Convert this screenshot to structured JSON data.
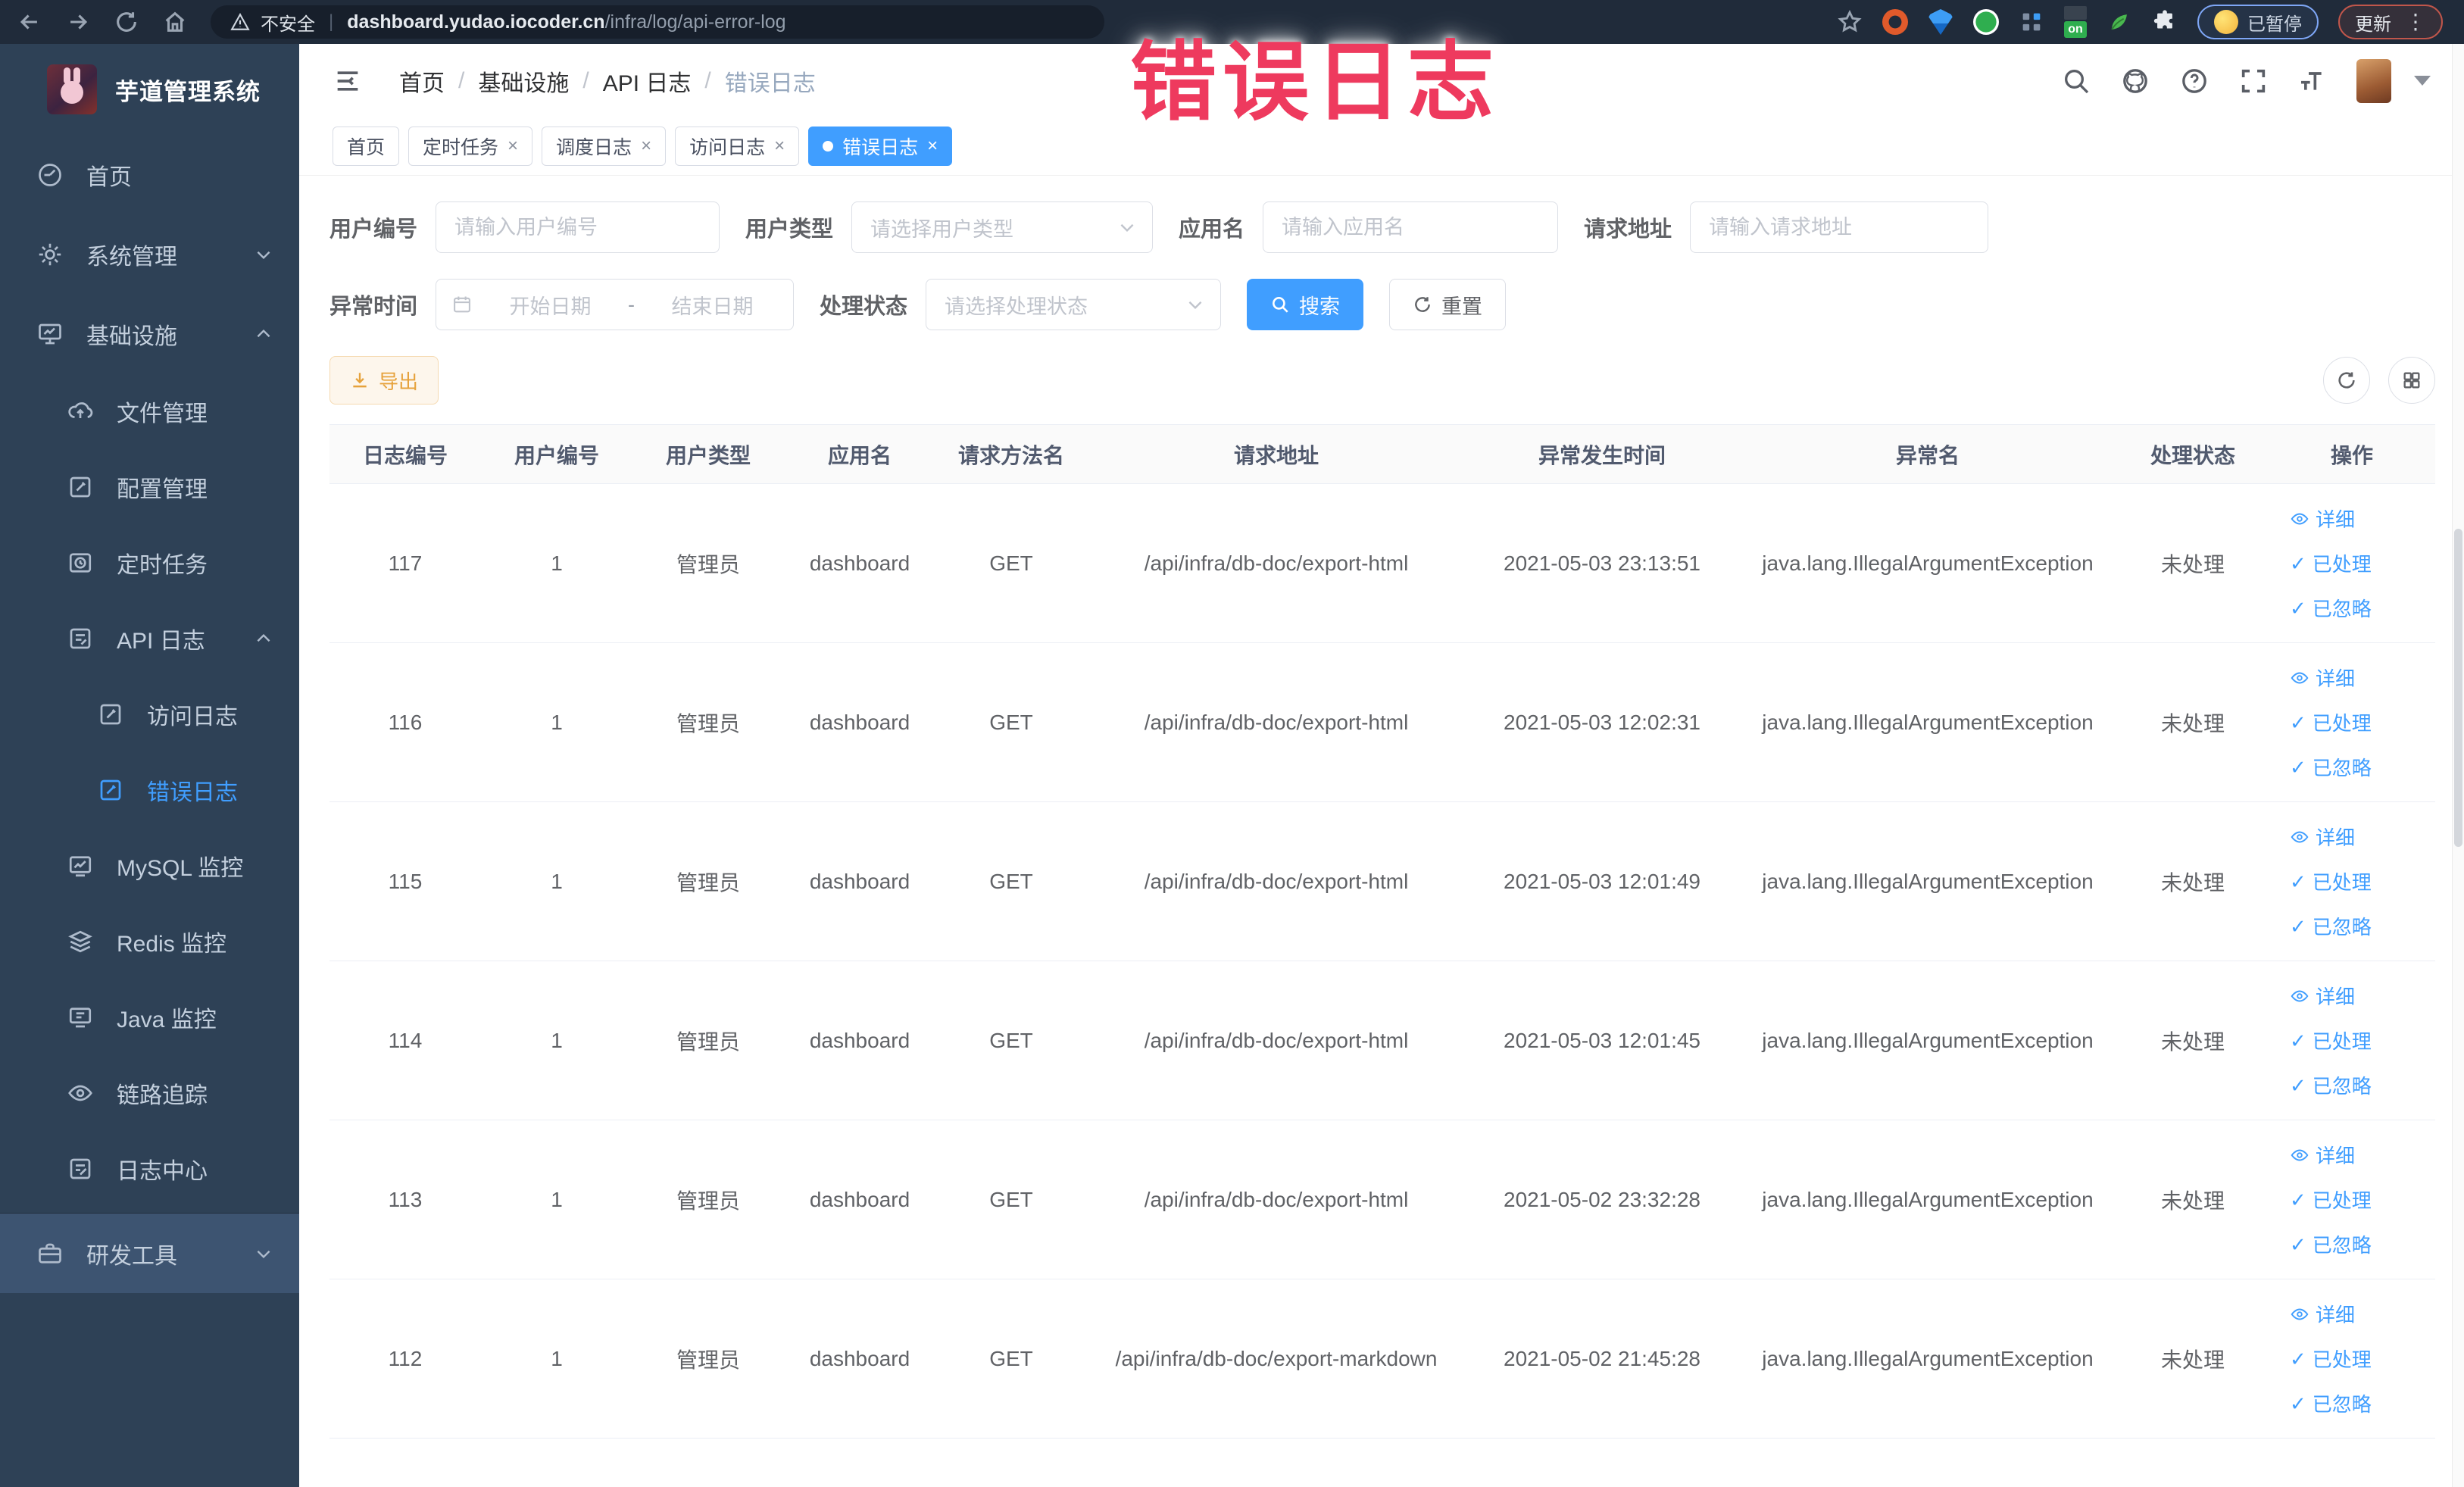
{
  "overlay_title": "错误日志",
  "browser": {
    "security": "不安全",
    "url_host": "dashboard.yudao.iocoder.cn",
    "url_path": "/infra/log/api-error-log",
    "ext_on_badge": "on",
    "paused_pill": "已暂停",
    "update_pill": "更新",
    "kebab": "⋮"
  },
  "sidebar": {
    "app_title": "芋道管理系统",
    "items": {
      "home": "首页",
      "system": "系统管理",
      "infra": "基础设施",
      "file": "文件管理",
      "config": "配置管理",
      "job": "定时任务",
      "api_log": "API 日志",
      "access_log": "访问日志",
      "error_log": "错误日志",
      "mysql": "MySQL 监控",
      "redis": "Redis 监控",
      "java": "Java 监控",
      "trace": "链路追踪",
      "log_center": "日志中心",
      "dev_tools": "研发工具"
    }
  },
  "header": {
    "breadcrumbs": [
      "首页",
      "基础设施",
      "API 日志",
      "错误日志"
    ],
    "separator": "/"
  },
  "tags": {
    "home": "首页",
    "job": "定时任务",
    "job_log": "调度日志",
    "access_log": "访问日志",
    "error_log": "错误日志",
    "close": "×"
  },
  "filters": {
    "user_id_label": "用户编号",
    "user_id_placeholder": "请输入用户编号",
    "user_type_label": "用户类型",
    "user_type_placeholder": "请选择用户类型",
    "app_name_label": "应用名",
    "app_name_placeholder": "请输入应用名",
    "request_url_label": "请求地址",
    "request_url_placeholder": "请输入请求地址",
    "exception_time_label": "异常时间",
    "date_start_placeholder": "开始日期",
    "date_separator": "-",
    "date_end_placeholder": "结束日期",
    "process_status_label": "处理状态",
    "process_status_placeholder": "请选择处理状态",
    "search_button": "搜索",
    "reset_button": "重置"
  },
  "toolbar": {
    "export_button": "导出"
  },
  "table": {
    "headers": [
      "日志编号",
      "用户编号",
      "用户类型",
      "应用名",
      "请求方法名",
      "请求地址",
      "异常发生时间",
      "异常名",
      "处理状态",
      "操作"
    ],
    "action_labels": {
      "detail": "详细",
      "processed": "已处理",
      "ignored": "已忽略"
    },
    "rows": [
      {
        "id": "117",
        "user_id": "1",
        "user_type": "管理员",
        "app": "dashboard",
        "method": "GET",
        "url": "/api/infra/db-doc/export-html",
        "time": "2021-05-03 23:13:51",
        "exception": "java.lang.IllegalArgumentException",
        "status": "未处理"
      },
      {
        "id": "116",
        "user_id": "1",
        "user_type": "管理员",
        "app": "dashboard",
        "method": "GET",
        "url": "/api/infra/db-doc/export-html",
        "time": "2021-05-03 12:02:31",
        "exception": "java.lang.IllegalArgumentException",
        "status": "未处理"
      },
      {
        "id": "115",
        "user_id": "1",
        "user_type": "管理员",
        "app": "dashboard",
        "method": "GET",
        "url": "/api/infra/db-doc/export-html",
        "time": "2021-05-03 12:01:49",
        "exception": "java.lang.IllegalArgumentException",
        "status": "未处理"
      },
      {
        "id": "114",
        "user_id": "1",
        "user_type": "管理员",
        "app": "dashboard",
        "method": "GET",
        "url": "/api/infra/db-doc/export-html",
        "time": "2021-05-03 12:01:45",
        "exception": "java.lang.IllegalArgumentException",
        "status": "未处理"
      },
      {
        "id": "113",
        "user_id": "1",
        "user_type": "管理员",
        "app": "dashboard",
        "method": "GET",
        "url": "/api/infra/db-doc/export-html",
        "time": "2021-05-02 23:32:28",
        "exception": "java.lang.IllegalArgumentException",
        "status": "未处理"
      },
      {
        "id": "112",
        "user_id": "1",
        "user_type": "管理员",
        "app": "dashboard",
        "method": "GET",
        "url": "/api/infra/db-doc/export-markdown",
        "time": "2021-05-02 21:45:28",
        "exception": "java.lang.IllegalArgumentException",
        "status": "未处理"
      }
    ]
  },
  "colors": {
    "accent": "#409eff",
    "overlay_pink": "#ee3a5e",
    "warning": "#e6a23c",
    "sidebar_bg": "#2e4156"
  }
}
